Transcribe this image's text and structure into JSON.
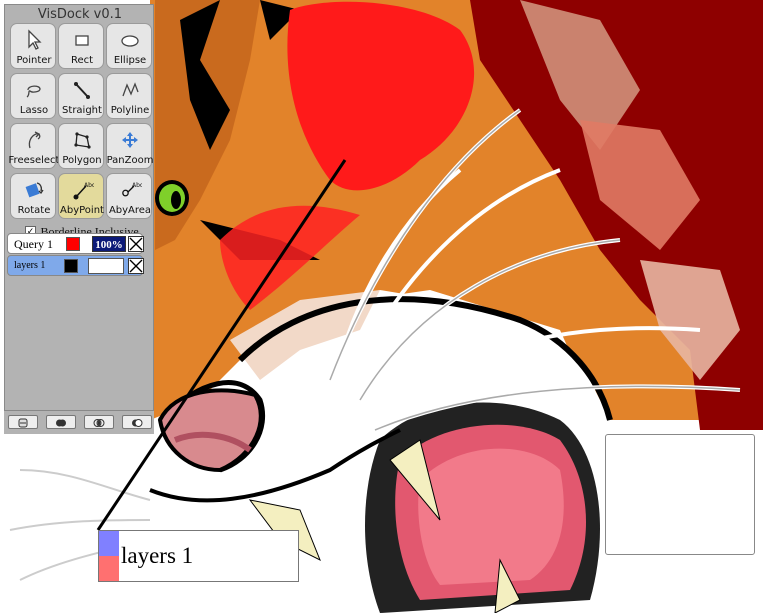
{
  "toolbox": {
    "title": "VisDock v0.1",
    "tools": [
      {
        "label": "Pointer",
        "icon": "pointer-icon"
      },
      {
        "label": "Rect",
        "icon": "rect-icon"
      },
      {
        "label": "Ellipse",
        "icon": "ellipse-icon"
      },
      {
        "label": "Lasso",
        "icon": "lasso-icon"
      },
      {
        "label": "Straight",
        "icon": "straight-line-icon"
      },
      {
        "label": "Polyline",
        "icon": "polyline-icon"
      },
      {
        "label": "Freeselect",
        "icon": "freeselect-icon"
      },
      {
        "label": "Polygon",
        "icon": "polygon-icon"
      },
      {
        "label": "PanZoom",
        "icon": "panzoom-icon"
      },
      {
        "label": "Rotate",
        "icon": "rotate-icon"
      },
      {
        "label": "AbyPoint",
        "icon": "annotate-point-icon",
        "active": true
      },
      {
        "label": "AbyArea",
        "icon": "annotate-area-icon"
      }
    ],
    "borderline_inclusive": {
      "label": "Borderline Inclusive",
      "checked": true
    },
    "layers": [
      {
        "name": "Query 1",
        "color": "#ff0000",
        "opacity": "100%"
      },
      {
        "name": "layers 1",
        "color": "#000000",
        "opacity": ""
      }
    ],
    "bottom_buttons": [
      "erase-icon",
      "union-icon",
      "intersect-icon",
      "exclude-icon"
    ]
  },
  "legend": {
    "label": "layers 1",
    "colors": [
      "#8080ff",
      "#ff7070"
    ]
  },
  "colors": {
    "panel_bg": "#b3b3b3",
    "selected_layer_bg": "#7fa9ea",
    "query_layer_bg": "#ffffff",
    "active_tool_bg": "#e3da9c"
  }
}
